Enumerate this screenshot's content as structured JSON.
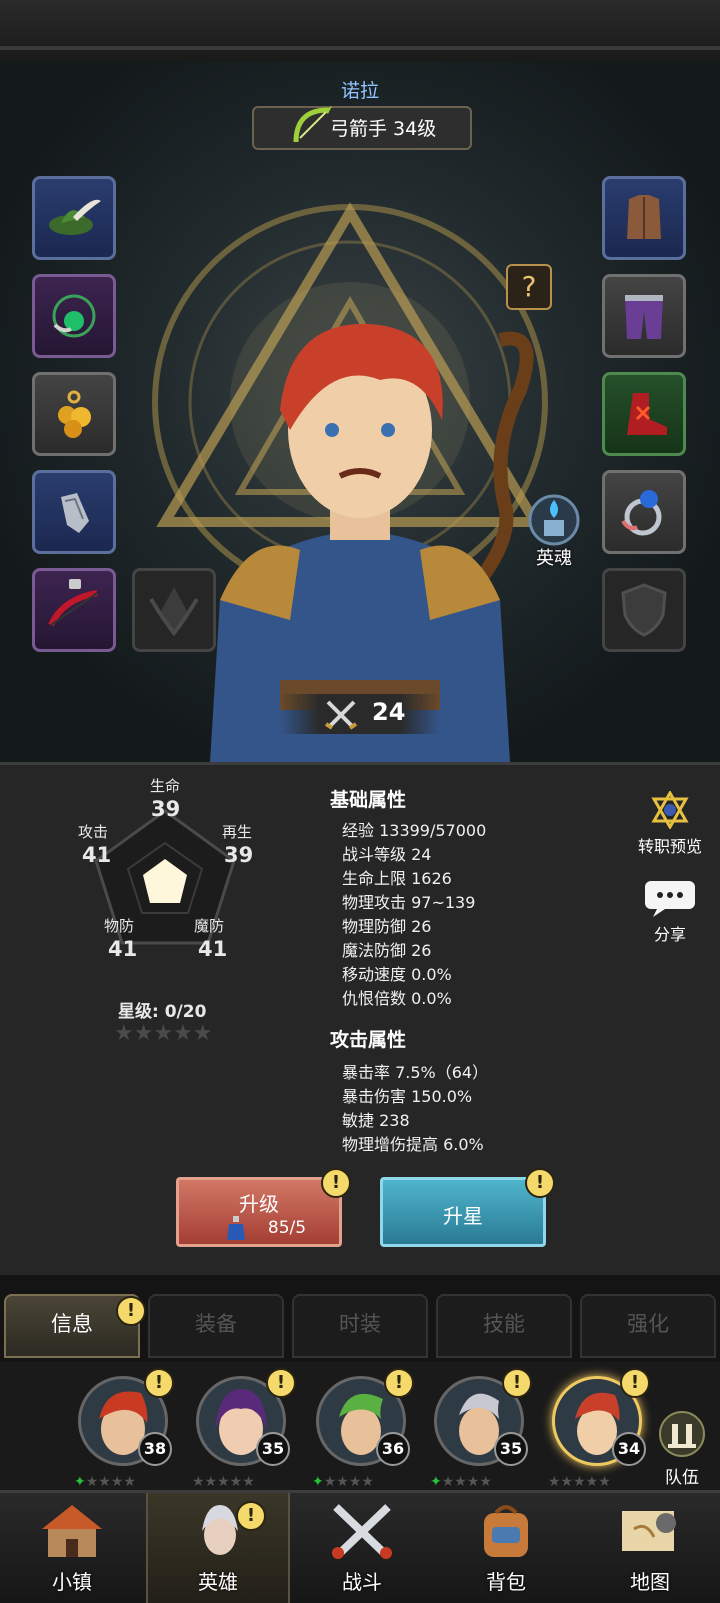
{
  "hero": {
    "name": "诺拉",
    "class_label": "弓箭手 34级",
    "soul_label": "英魂",
    "combat_power": "24",
    "question_mark": "?"
  },
  "radar": {
    "life_label": "生命",
    "life_value": "39",
    "attack_label": "攻击",
    "attack_value": "41",
    "regen_label": "再生",
    "regen_value": "39",
    "pdef_label": "物防",
    "pdef_value": "41",
    "mdef_label": "魔防",
    "mdef_value": "41",
    "star_level": "星级: 0/20",
    "stars": "★★★★★"
  },
  "basic_attrs": {
    "title": "基础属性",
    "items": [
      "经验 13399/57000",
      "战斗等级 24",
      "生命上限 1626",
      "物理攻击 97~139",
      "物理防御 26",
      "魔法防御 26",
      "移动速度 0.0%",
      "仇恨倍数 0.0%"
    ]
  },
  "attack_attrs": {
    "title": "攻击属性",
    "items": [
      "暴击率 7.5%（64）",
      "暴击伤害 150.0%",
      "敏捷 238",
      "物理增伤提高 6.0%"
    ]
  },
  "side_buttons": {
    "class_preview": "转职预览",
    "share": "分享"
  },
  "actions": {
    "upgrade_label": "升级",
    "upgrade_cost": "85/5",
    "star_up_label": "升星",
    "alert_mark": "!"
  },
  "tabs": [
    "信息",
    "装备",
    "时装",
    "技能",
    "强化"
  ],
  "roster": {
    "levels": [
      "38",
      "35",
      "36",
      "35",
      "34"
    ],
    "team_label": "队伍"
  },
  "nav": [
    "小镇",
    "英雄",
    "战斗",
    "背包",
    "地图"
  ],
  "colors": {
    "accent_gold": "#f0c860",
    "name_blue": "#8fc4ff",
    "alert_yellow": "#f5d96a",
    "upgrade_red": "#a43f33",
    "star_cyan": "#2a7a94"
  }
}
